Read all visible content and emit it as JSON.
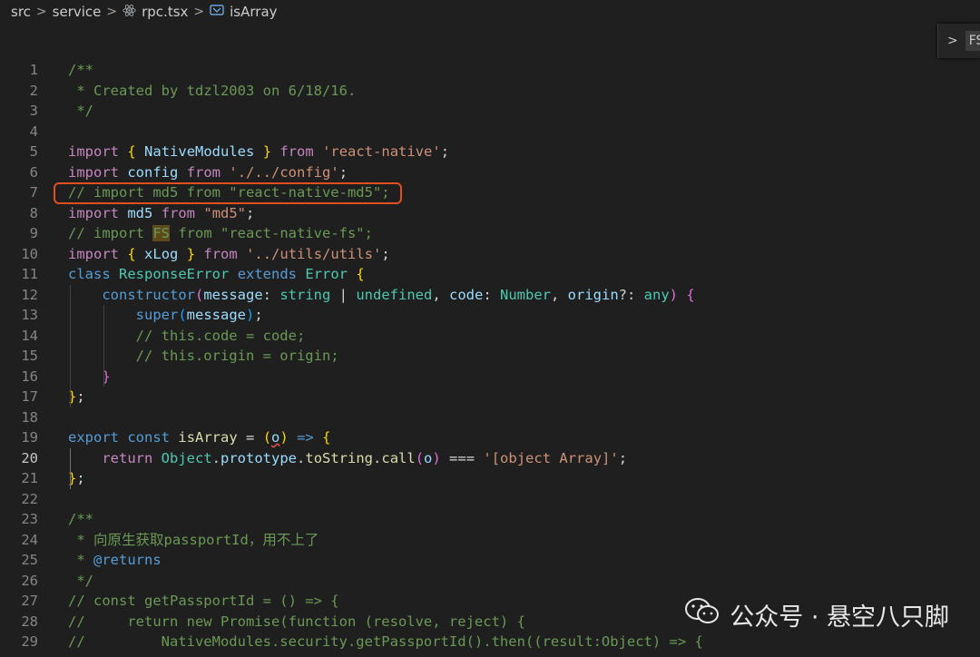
{
  "breadcrumb": {
    "items": [
      "src",
      "service",
      "rpc.tsx",
      "isArray"
    ],
    "separator": ">"
  },
  "find_widget": {
    "chevron": ">",
    "label": "FS"
  },
  "editor": {
    "active_line": 20,
    "lines": [
      {
        "n": "1",
        "tokens": [
          [
            "cm",
            "/**"
          ]
        ]
      },
      {
        "n": "2",
        "tokens": [
          [
            "cm",
            " * Created by tdzl2003 on 6/18/16."
          ]
        ]
      },
      {
        "n": "3",
        "tokens": [
          [
            "cm",
            " */"
          ]
        ]
      },
      {
        "n": "4",
        "tokens": []
      },
      {
        "n": "5",
        "tokens": [
          [
            "ctrl",
            "import"
          ],
          [
            "pl",
            " "
          ],
          [
            "br1",
            "{"
          ],
          [
            "pl",
            " "
          ],
          [
            "id",
            "NativeModules"
          ],
          [
            "pl",
            " "
          ],
          [
            "br1",
            "}"
          ],
          [
            "pl",
            " "
          ],
          [
            "ctrl",
            "from"
          ],
          [
            "pl",
            " "
          ],
          [
            "str",
            "'react-native'"
          ],
          [
            "pl",
            ";"
          ]
        ]
      },
      {
        "n": "6",
        "tokens": [
          [
            "ctrl",
            "import"
          ],
          [
            "pl",
            " "
          ],
          [
            "id",
            "config"
          ],
          [
            "pl",
            " "
          ],
          [
            "ctrl",
            "from"
          ],
          [
            "pl",
            " "
          ],
          [
            "str",
            "'./../config'"
          ],
          [
            "pl",
            ";"
          ]
        ]
      },
      {
        "n": "7",
        "tokens": [
          [
            "cm",
            "// import md5 from \"react-native-md5\";"
          ]
        ]
      },
      {
        "n": "8",
        "tokens": [
          [
            "ctrl",
            "import"
          ],
          [
            "pl",
            " "
          ],
          [
            "id",
            "md5"
          ],
          [
            "pl",
            " "
          ],
          [
            "ctrl",
            "from"
          ],
          [
            "pl",
            " "
          ],
          [
            "str",
            "\"md5\""
          ],
          [
            "pl",
            ";"
          ]
        ]
      },
      {
        "n": "9",
        "tokens": [
          [
            "cm",
            "// import "
          ],
          [
            "cm hl-fs",
            "FS"
          ],
          [
            "cm",
            " from \"react-native-fs\";"
          ]
        ]
      },
      {
        "n": "10",
        "tokens": [
          [
            "ctrl",
            "import"
          ],
          [
            "pl",
            " "
          ],
          [
            "br1",
            "{"
          ],
          [
            "pl",
            " "
          ],
          [
            "id",
            "xLog"
          ],
          [
            "pl",
            " "
          ],
          [
            "br1",
            "}"
          ],
          [
            "pl",
            " "
          ],
          [
            "ctrl",
            "from"
          ],
          [
            "pl",
            " "
          ],
          [
            "str",
            "'../utils/utils'"
          ],
          [
            "pl",
            ";"
          ]
        ]
      },
      {
        "n": "11",
        "tokens": [
          [
            "kw",
            "class"
          ],
          [
            "pl",
            " "
          ],
          [
            "ty",
            "ResponseError"
          ],
          [
            "pl",
            " "
          ],
          [
            "kw",
            "extends"
          ],
          [
            "pl",
            " "
          ],
          [
            "ty",
            "Error"
          ],
          [
            "pl",
            " "
          ],
          [
            "br1",
            "{"
          ]
        ]
      },
      {
        "n": "12",
        "tokens": [
          [
            "pl",
            "    "
          ],
          [
            "kw",
            "constructor"
          ],
          [
            "br2",
            "("
          ],
          [
            "id",
            "message"
          ],
          [
            "pl",
            ": "
          ],
          [
            "ty",
            "string"
          ],
          [
            "pl",
            " | "
          ],
          [
            "ty",
            "undefined"
          ],
          [
            "pl",
            ", "
          ],
          [
            "id",
            "code"
          ],
          [
            "pl",
            ": "
          ],
          [
            "ty",
            "Number"
          ],
          [
            "pl",
            ", "
          ],
          [
            "id",
            "origin"
          ],
          [
            "pl",
            "?: "
          ],
          [
            "ty",
            "any"
          ],
          [
            "br2",
            ")"
          ],
          [
            "pl",
            " "
          ],
          [
            "br2",
            "{"
          ]
        ]
      },
      {
        "n": "13",
        "tokens": [
          [
            "pl",
            "        "
          ],
          [
            "kw",
            "super"
          ],
          [
            "br3",
            "("
          ],
          [
            "id",
            "message"
          ],
          [
            "br3",
            ")"
          ],
          [
            "pl",
            ";"
          ]
        ]
      },
      {
        "n": "14",
        "tokens": [
          [
            "pl",
            "        "
          ],
          [
            "cm",
            "// this.code = code;"
          ]
        ]
      },
      {
        "n": "15",
        "tokens": [
          [
            "pl",
            "        "
          ],
          [
            "cm",
            "// this.origin = origin;"
          ]
        ]
      },
      {
        "n": "16",
        "tokens": [
          [
            "pl",
            "    "
          ],
          [
            "br2",
            "}"
          ]
        ]
      },
      {
        "n": "17",
        "tokens": [
          [
            "br1",
            "}"
          ],
          [
            "pl",
            ";"
          ]
        ]
      },
      {
        "n": "18",
        "tokens": []
      },
      {
        "n": "19",
        "tokens": [
          [
            "kw",
            "export"
          ],
          [
            "pl",
            " "
          ],
          [
            "kw",
            "const"
          ],
          [
            "pl",
            " "
          ],
          [
            "fn",
            "isArray"
          ],
          [
            "pl",
            " = "
          ],
          [
            "br1",
            "("
          ],
          [
            "id squig",
            "o"
          ],
          [
            "br1",
            ")"
          ],
          [
            "pl",
            " "
          ],
          [
            "kw",
            "=>"
          ],
          [
            "pl",
            " "
          ],
          [
            "br1",
            "{"
          ]
        ]
      },
      {
        "n": "20",
        "tokens": [
          [
            "pl",
            "    "
          ],
          [
            "ctrl",
            "return"
          ],
          [
            "pl",
            " "
          ],
          [
            "ty",
            "Object"
          ],
          [
            "pl",
            "."
          ],
          [
            "id",
            "prototype"
          ],
          [
            "pl",
            "."
          ],
          [
            "fn",
            "toString"
          ],
          [
            "pl",
            "."
          ],
          [
            "fn",
            "call"
          ],
          [
            "br2",
            "("
          ],
          [
            "id",
            "o"
          ],
          [
            "br2",
            ")"
          ],
          [
            "pl",
            " === "
          ],
          [
            "str",
            "'[object Array]'"
          ],
          [
            "pl",
            ";"
          ]
        ]
      },
      {
        "n": "21",
        "tokens": [
          [
            "br1",
            "}"
          ],
          [
            "pl",
            ";"
          ]
        ]
      },
      {
        "n": "22",
        "tokens": []
      },
      {
        "n": "23",
        "tokens": [
          [
            "cm",
            "/**"
          ]
        ]
      },
      {
        "n": "24",
        "tokens": [
          [
            "cm",
            " * 向原生获取passportId，用不上了"
          ]
        ]
      },
      {
        "n": "25",
        "tokens": [
          [
            "cm",
            " * "
          ],
          [
            "doc",
            "@returns"
          ]
        ]
      },
      {
        "n": "26",
        "tokens": [
          [
            "cm",
            " */"
          ]
        ]
      },
      {
        "n": "27",
        "tokens": [
          [
            "cm",
            "// const getPassportId = () => {"
          ]
        ]
      },
      {
        "n": "28",
        "tokens": [
          [
            "cm",
            "//     return new Promise(function (resolve, reject) {"
          ]
        ]
      },
      {
        "n": "29",
        "tokens": [
          [
            "cm",
            "//         NativeModules.security.getPassportId().then((result:Object) => {"
          ]
        ]
      }
    ]
  },
  "watermark": {
    "text": "公众号 · 悬空八只脚",
    "icon": "wechat-icon"
  },
  "colors": {
    "background": "#1f1f1f",
    "annotation_box": "#e0501f"
  }
}
